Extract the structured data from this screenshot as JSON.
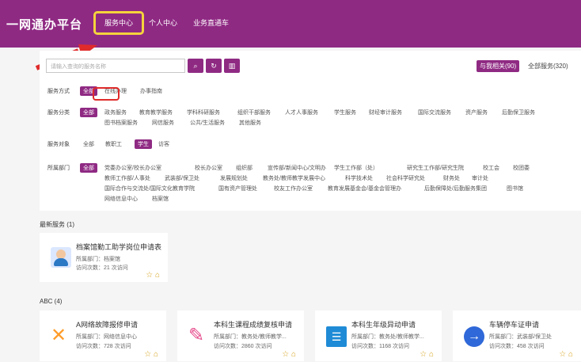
{
  "header": {
    "logo": "一网通办平台",
    "nav": [
      "服务中心",
      "个人中心",
      "业务直通车"
    ]
  },
  "search": {
    "placeholder": "请输入查询的服务名称",
    "related": "与我相关(90)",
    "all": "全部服务(320)"
  },
  "filters": {
    "service_mode_label": "服务方式",
    "service_mode_items": [
      "全部",
      "在线办理",
      "办事指南"
    ],
    "category_label": "服务分类",
    "category_items_line1": [
      "全部",
      "政务服务",
      "教育教学服务",
      "学科科研服务",
      "组织干部服务",
      "人才人事服务",
      "学生服务",
      "财经审计服务",
      "国际交流服务",
      "资产服务",
      "后勤保卫服务"
    ],
    "category_items_line2": [
      "图书档案服务",
      "网信服务",
      "公共/生活服务",
      "其他服务"
    ],
    "target_label": "服务对象",
    "target_items": [
      "全部",
      "教职工",
      "学生",
      "访客"
    ],
    "department_label": "所属部门",
    "department_line1": [
      "全部",
      "党委办公室/校长办公室",
      "校长办公室",
      "组织部",
      "宣传部/新闻中心/文明办",
      "学生工作部（处）",
      "研究生工作部/研究生院",
      "校工会",
      "校团委"
    ],
    "department_line2": [
      "教师工作部/人事处",
      "武装部/保卫处",
      "发展规划处",
      "教务处/教师教学发展中心",
      "科学技术处",
      "社会科学研究处",
      "财务处",
      "审计处"
    ],
    "department_line3": [
      "国际合作与交流处/国际文化教育学院",
      "国有资产管理处",
      "校友工作办公室",
      "教育发展基金会/基金会管理办",
      "后勤保障处/后勤服务集团",
      "图书馆"
    ],
    "department_line4": [
      "网络信息中心",
      "档案馆"
    ]
  },
  "sections": {
    "latest": "最新服务 (1)",
    "abc": "ABC (4)"
  },
  "cards": [
    {
      "title": "档案馆勤工助学岗位申请表",
      "dept": "所属部门：档案馆",
      "visits": "访问次数：21 次访问"
    },
    {
      "title": "A网络故障报修申请",
      "dept": "所属部门：网络信息中心",
      "visits": "访问次数：728 次访问"
    },
    {
      "title": "本科生课程成绩复核申请",
      "dept": "所属部门：教务处/教师教学...",
      "visits": "访问次数：2860 次访问"
    },
    {
      "title": "本科生年级异动申请",
      "dept": "所属部门：教务处/教师教学...",
      "visits": "访问次数：1168 次访问"
    },
    {
      "title": "车辆停车证申请",
      "dept": "所属部门：武装部/保卫处",
      "visits": "访问次数：458 次访问"
    }
  ]
}
